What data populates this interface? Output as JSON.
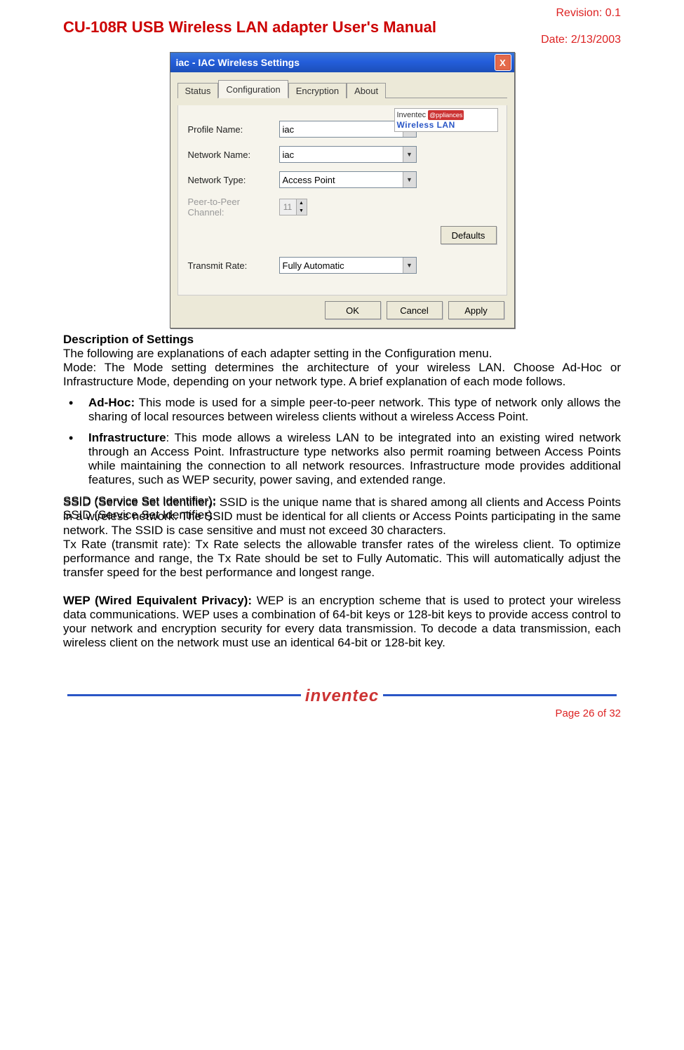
{
  "header": {
    "revision_label": "Revision:",
    "revision_value": "0.1",
    "title": "CU-108R USB Wireless LAN adapter User's Manual",
    "date_label": "Date:",
    "date_value": "2/13/2003"
  },
  "dialog": {
    "title": "iac - IAC Wireless Settings",
    "close": "X",
    "tabs": {
      "status": "Status",
      "configuration": "Configuration",
      "encryption": "Encryption",
      "about": "About"
    },
    "logo": {
      "line1a": "Inventec",
      "line1b": "@ppliances",
      "line2": "Wireless LAN"
    },
    "fields": {
      "profile_name": {
        "label": "Profile Name:",
        "value": "iac"
      },
      "network_name": {
        "label": "Network Name:",
        "value": "iac"
      },
      "network_type": {
        "label": "Network Type:",
        "value": "Access Point"
      },
      "p2p_channel": {
        "label": "Peer-to-Peer Channel:",
        "value": "11"
      },
      "transmit_rate": {
        "label": "Transmit Rate:",
        "value": "Fully Automatic"
      }
    },
    "buttons": {
      "defaults": "Defaults",
      "ok": "OK",
      "cancel": "Cancel",
      "apply": "Apply"
    }
  },
  "body": {
    "desc_heading": "Description of Settings",
    "intro": "The following are explanations of each adapter setting in the Configuration menu.",
    "mode_para": "Mode: The Mode setting determines the architecture of your wireless LAN. Choose Ad-Hoc or Infrastructure Mode, depending on your network type. A brief explanation of each mode follows.",
    "adhoc_label": "Ad-Hoc:",
    "adhoc_text": " This mode is used for a simple peer-to-peer network. This type of network only allows the sharing of local resources between wireless clients without a wireless Access Point.",
    "infra_label": "Infrastructure",
    "infra_text": ": This mode allows a wireless LAN to be integrated into an existing wired network through an Access Point. Infrastructure type networks also permit roaming between Access Points while maintaining the connection to all network resources. Infrastructure mode provides additional features, such as WEP security, power saving, and extended range.",
    "ssid_label": "SSID (Service Set Identifier)",
    "ssid_text": ": SSID is the unique name that is shared among all clients and Access Points in a wireless network. The SSID must be identical for all clients or Access Points participating in the same network. The SSID is case sensitive and must not exceed 30 characters.",
    "txrate_label": "Tx Rate (transmit rate)",
    "txrate_text": ": Tx Rate selects the allowable transfer rates of the wireless client. To optimize performance and range, the Tx Rate should be set to Fully Automatic. This will automatically adjust the transfer speed for the best performance and longest range.",
    "wep_label": "WEP (Wired Equivalent Privacy):",
    "wep_text": " WEP is an encryption scheme that is used to protect your wireless data communications. WEP uses a combination of 64-bit keys or 128-bit keys to provide access control to your network and encryption security for every data transmission. To decode a data transmission, each wireless client on the network must use an identical 64-bit or 128-bit key."
  },
  "footer": {
    "logo": "inventec",
    "page_label_1": "Page",
    "page_current": "26",
    "page_of": "of",
    "page_total": "32"
  }
}
